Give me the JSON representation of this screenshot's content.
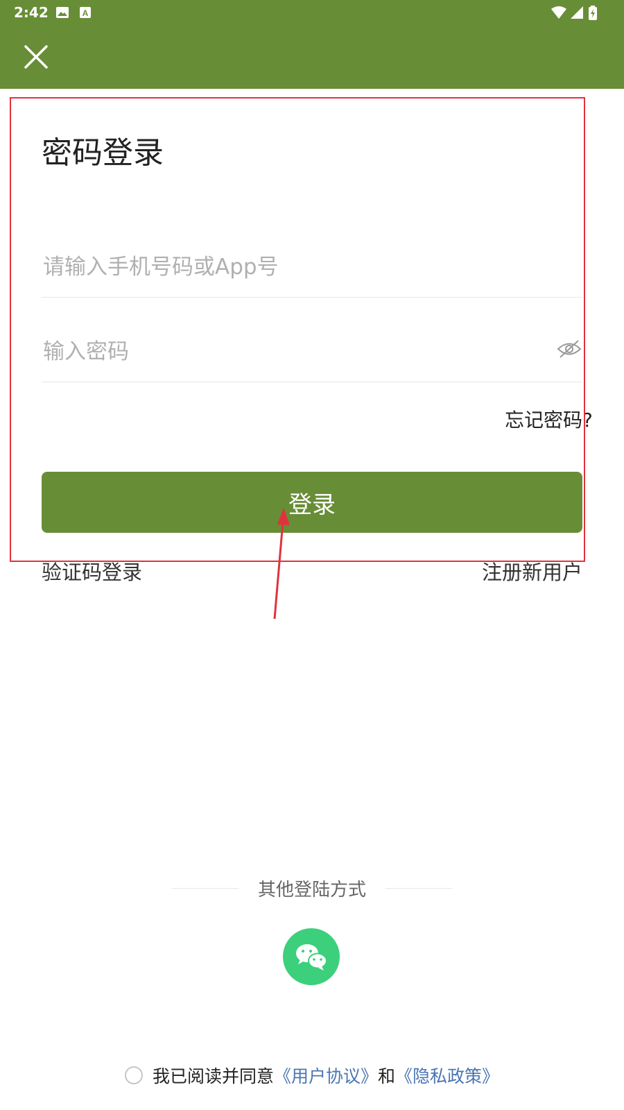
{
  "status_bar": {
    "time": "2:42"
  },
  "header": {
    "close_icon": "close-icon",
    "accent_color": "#688d37"
  },
  "main": {
    "title": "密码登录",
    "phone_input": {
      "placeholder": "请输入手机号码或App号",
      "value": ""
    },
    "password_input": {
      "placeholder": "输入密码",
      "value": ""
    },
    "forgot_password": "忘记密码?",
    "login_button": "登录",
    "sms_login": "验证码登录",
    "register": "注册新用户"
  },
  "other_login": {
    "label": "其他登陆方式",
    "wechat_icon": "wechat-icon",
    "wechat_color": "#3ccf7c"
  },
  "agreement": {
    "checked": false,
    "text_prefix": "我已阅读并同意",
    "user_agreement": "《用户协议》",
    "and": "和",
    "privacy_policy": "《隐私政策》"
  },
  "annotation": {
    "color": "#e0323c"
  }
}
